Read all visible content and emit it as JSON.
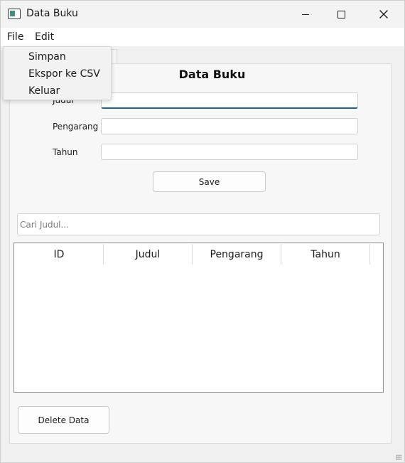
{
  "window": {
    "title": "Data Buku"
  },
  "icons": {
    "app": "app-window-icon",
    "minimize": "minimize-icon",
    "maximize": "maximize-icon",
    "close": "close-icon"
  },
  "menubar": {
    "file": "File",
    "edit": "Edit"
  },
  "file_menu": {
    "items": [
      "Simpan",
      "Ekspor ke CSV",
      "Keluar"
    ]
  },
  "form": {
    "title": "Data Buku",
    "labels": {
      "judul": "Judul",
      "pengarang": "Pengarang",
      "tahun": "Tahun"
    },
    "values": {
      "judul": "",
      "pengarang": "",
      "tahun": ""
    },
    "save_label": "Save"
  },
  "search": {
    "placeholder": "Cari Judul...",
    "value": ""
  },
  "table": {
    "columns": [
      "ID",
      "Judul",
      "Pengarang",
      "Tahun"
    ],
    "rows": []
  },
  "delete_label": "Delete Data",
  "colors": {
    "focus_underline": "#1f5fa0",
    "icon_accent": "#3b8f84"
  }
}
